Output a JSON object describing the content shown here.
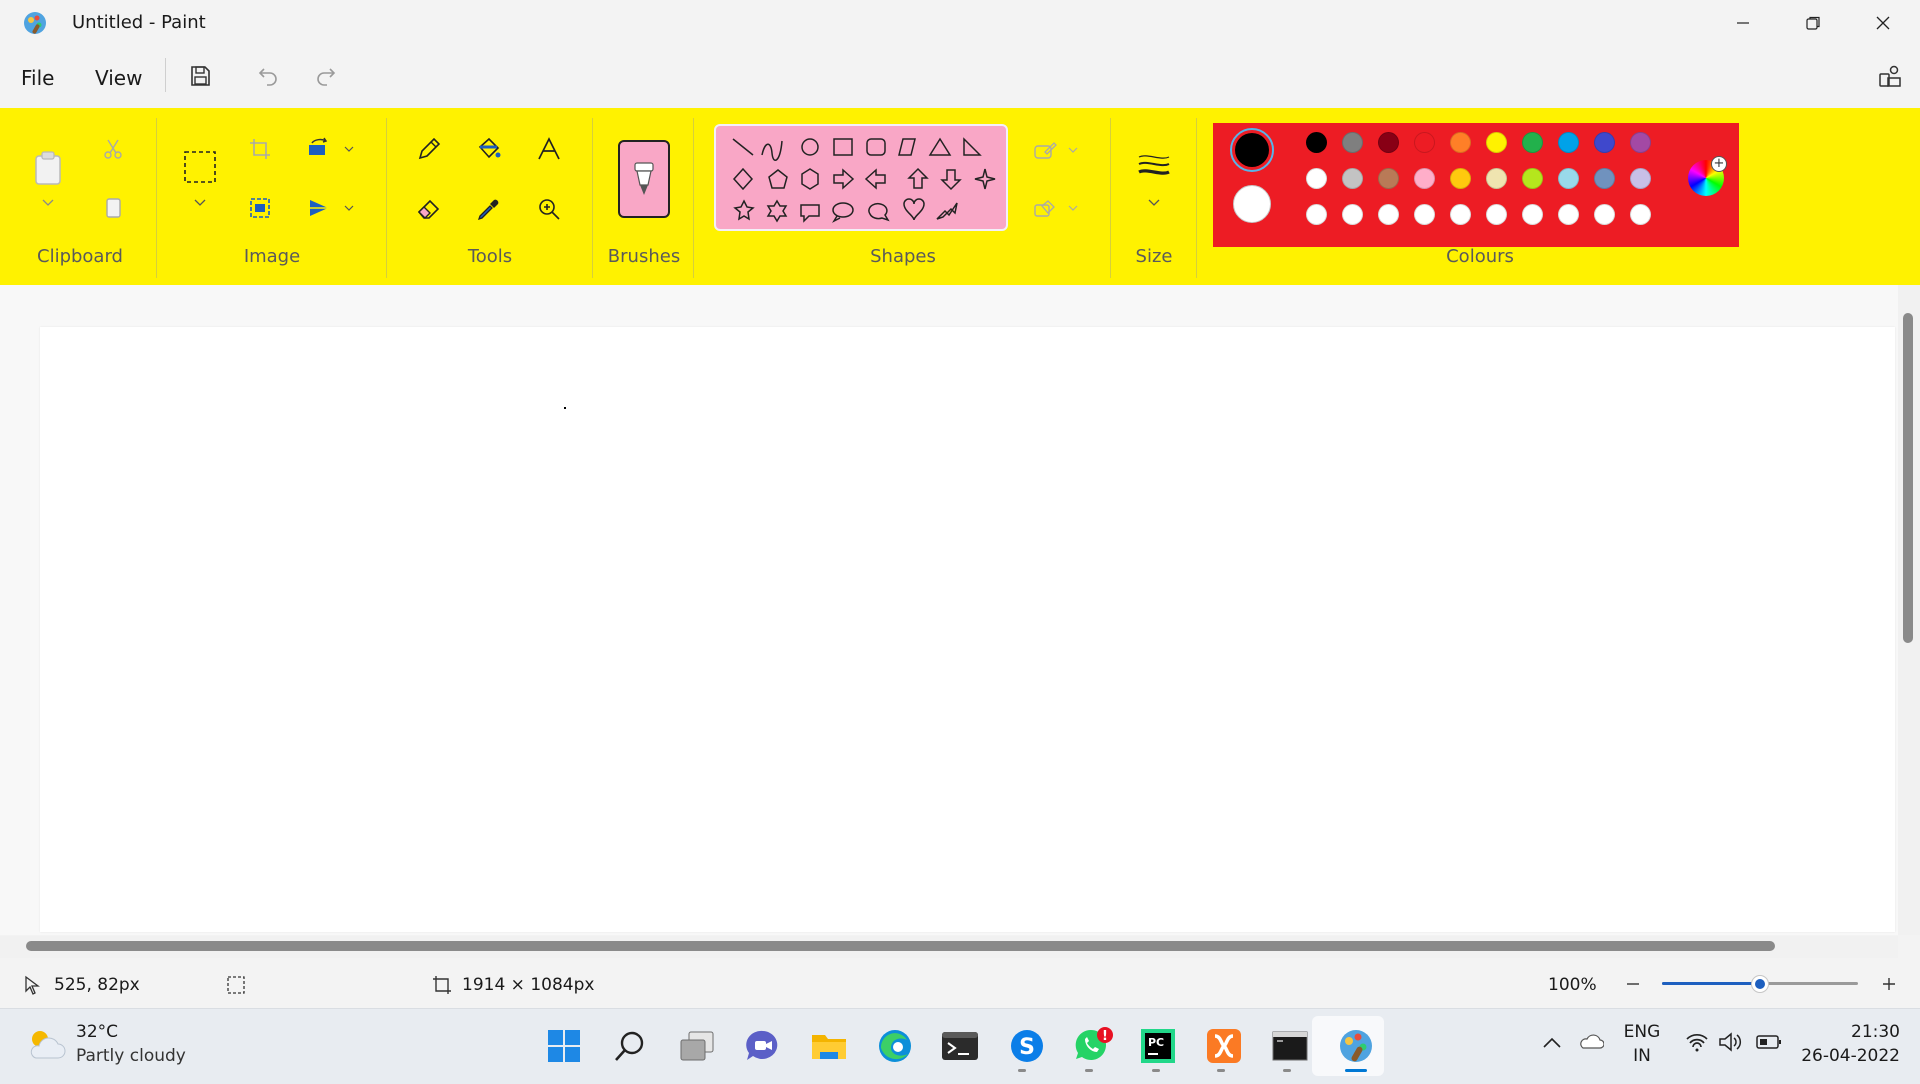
{
  "window": {
    "title": "Untitled - Paint",
    "controls": [
      "minimize",
      "restore",
      "close"
    ]
  },
  "menu": {
    "file_label": "File",
    "view_label": "View",
    "quick_actions": [
      "save-icon",
      "undo-icon",
      "redo-icon"
    ]
  },
  "ribbon": {
    "groups": {
      "clipboard": "Clipboard",
      "image": "Image",
      "tools": "Tools",
      "brushes": "Brushes",
      "shapes": "Shapes",
      "size": "Size",
      "colours": "Colours"
    },
    "colors": {
      "ribbon_bg": "#fff200",
      "shapes_panel_bg": "#f9a7c6",
      "colours_panel_bg": "#ed1c24"
    },
    "palette": [
      [
        "#000000",
        "#7f7f7f",
        "#880015",
        "#ed1c24",
        "#ff7f27",
        "#fff200",
        "#22b14c",
        "#00a2e8",
        "#3f48cc",
        "#a349a4"
      ],
      [
        "#ffffff",
        "#c3c3c3",
        "#b97a57",
        "#ffaec9",
        "#ffc90e",
        "#efe4b0",
        "#b5e61d",
        "#99d9ea",
        "#7092be",
        "#c8bfe7"
      ],
      [
        "#ffffff",
        "#ffffff",
        "#ffffff",
        "#ffffff",
        "#ffffff",
        "#ffffff",
        "#ffffff",
        "#ffffff",
        "#ffffff",
        "#ffffff"
      ]
    ],
    "primary_color": "#000000",
    "secondary_color": "#ffffff"
  },
  "status": {
    "cursor_position": "525, 82px",
    "canvas_size": "1914 × 1084px",
    "zoom": "100%",
    "zoom_level": 0.5
  },
  "taskbar": {
    "weather_temp": "32°C",
    "weather_desc": "Partly cloudy",
    "lang_line1": "ENG",
    "lang_line2": "IN",
    "time": "21:30",
    "date": "26-04-2022",
    "apps": [
      "start",
      "search",
      "task-view",
      "teams-chat",
      "file-explorer",
      "edge",
      "terminal",
      "skype",
      "whatsapp",
      "pycharm",
      "xampp",
      "command-prompt",
      "paint"
    ]
  }
}
